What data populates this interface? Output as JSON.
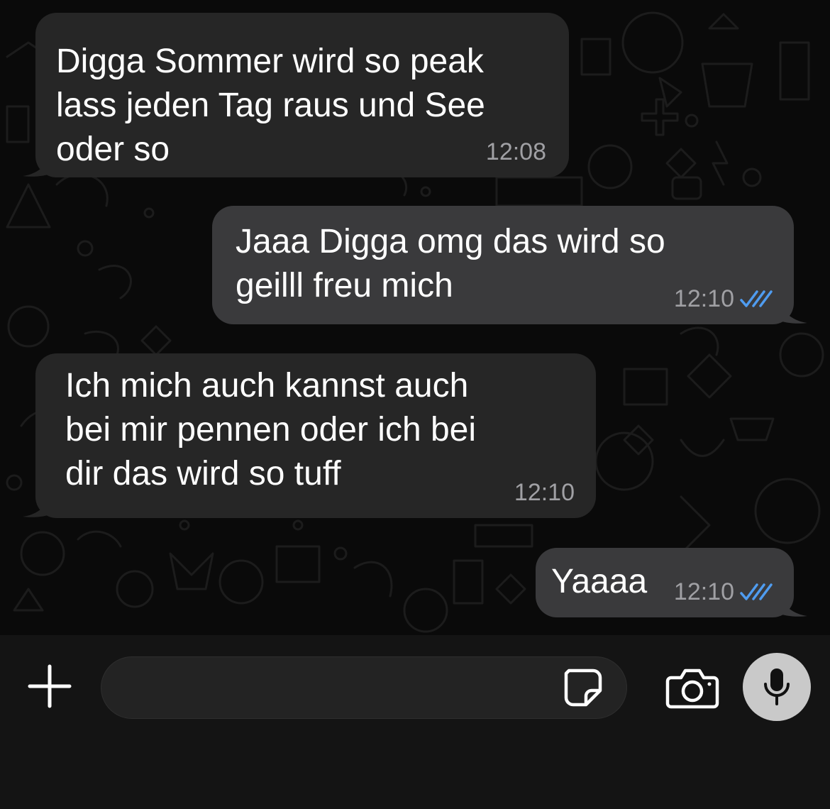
{
  "messages": [
    {
      "direction": "incoming",
      "text": "Digga Sommer wird so peak\nlass jeden Tag raus und See\noder so",
      "time": "12:08"
    },
    {
      "direction": "outgoing",
      "text": "Jaaa Digga omg das wird so\ngeilll freu mich",
      "time": "12:10",
      "status": "read"
    },
    {
      "direction": "incoming",
      "text": "Ich mich auch kannst auch\nbei mir pennen oder ich bei\ndir das wird so tuff",
      "time": "12:10"
    },
    {
      "direction": "outgoing",
      "text": "Yaaaa",
      "time": "12:10",
      "status": "read"
    }
  ],
  "composer": {
    "value": "",
    "placeholder": ""
  },
  "icons": {
    "attach": "plus-icon",
    "sticker": "sticker-icon",
    "camera": "camera-icon",
    "mic": "microphone-icon",
    "read_receipt": "double-check-icon"
  },
  "colors": {
    "incoming_bubble": "#262626",
    "outgoing_bubble": "#3a3a3c",
    "read_receipt": "#4f9cf0",
    "timestamp": "#a0a0a4"
  }
}
